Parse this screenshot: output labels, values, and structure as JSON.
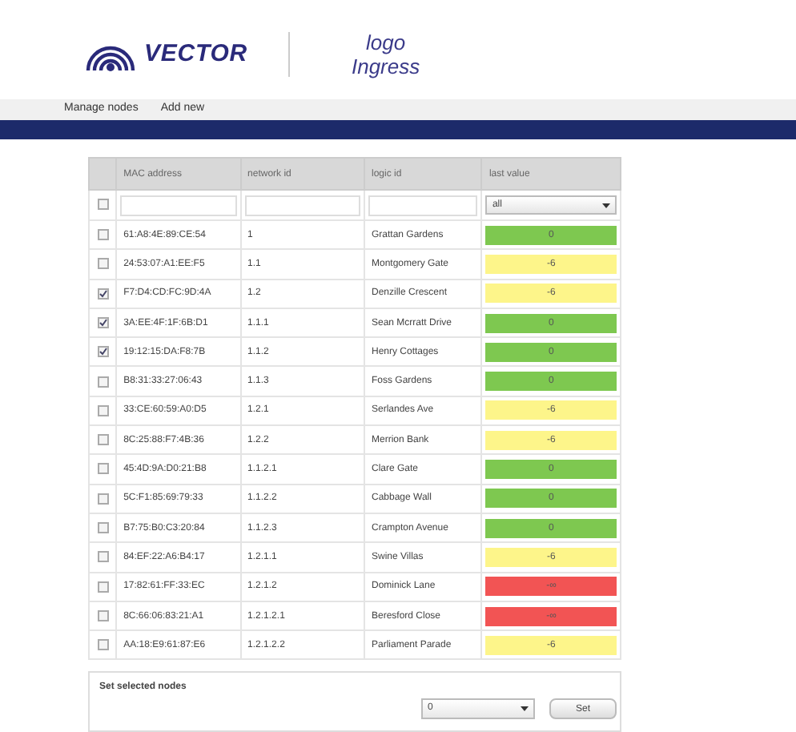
{
  "header": {
    "brand": "VECTOR",
    "tagline_1": "logo",
    "tagline_2": "Ingress"
  },
  "nav": [
    {
      "label": "Manage nodes"
    },
    {
      "label": "Add new"
    }
  ],
  "table": {
    "columns": [
      "MAC address",
      "network id",
      "logic id",
      "last value"
    ],
    "filter": {
      "checked": false,
      "value_filter": "all"
    },
    "rows": [
      {
        "checked": false,
        "mac": "61:A8:4E:89:CE:54",
        "network_id": "1",
        "logic_id": "Grattan Gardens",
        "value": "0",
        "color": "#7ec850"
      },
      {
        "checked": false,
        "mac": "24:53:07:A1:EE:F5",
        "network_id": "1.1",
        "logic_id": "Montgomery Gate",
        "value": "-6",
        "color": "#fdf58a"
      },
      {
        "checked": true,
        "mac": "F7:D4:CD:FC:9D:4A",
        "network_id": "1.2",
        "logic_id": "Denzille Crescent",
        "value": "-6",
        "color": "#fdf58a"
      },
      {
        "checked": true,
        "mac": "3A:EE:4F:1F:6B:D1",
        "network_id": "1.1.1",
        "logic_id": "Sean Mcrratt Drive",
        "value": "0",
        "color": "#7ec850"
      },
      {
        "checked": true,
        "mac": "19:12:15:DA:F8:7B",
        "network_id": "1.1.2",
        "logic_id": "Henry Cottages",
        "value": "0",
        "color": "#7ec850"
      },
      {
        "checked": false,
        "mac": "B8:31:33:27:06:43",
        "network_id": "1.1.3",
        "logic_id": "Foss Gardens",
        "value": "0",
        "color": "#7ec850"
      },
      {
        "checked": false,
        "mac": "33:CE:60:59:A0:D5",
        "network_id": "1.2.1",
        "logic_id": "Serlandes Ave",
        "value": "-6",
        "color": "#fdf58a"
      },
      {
        "checked": false,
        "mac": "8C:25:88:F7:4B:36",
        "network_id": "1.2.2",
        "logic_id": "Merrion Bank",
        "value": "-6",
        "color": "#fdf58a"
      },
      {
        "checked": false,
        "mac": "45:4D:9A:D0:21:B8",
        "network_id": "1.1.2.1",
        "logic_id": "Clare Gate",
        "value": "0",
        "color": "#7ec850"
      },
      {
        "checked": false,
        "mac": "5C:F1:85:69:79:33",
        "network_id": "1.1.2.2",
        "logic_id": "Cabbage Wall",
        "value": "0",
        "color": "#7ec850"
      },
      {
        "checked": false,
        "mac": "B7:75:B0:C3:20:84",
        "network_id": "1.1.2.3",
        "logic_id": "Crampton Avenue",
        "value": "0",
        "color": "#7ec850"
      },
      {
        "checked": false,
        "mac": "84:EF:22:A6:B4:17",
        "network_id": "1.2.1.1",
        "logic_id": "Swine Villas",
        "value": "-6",
        "color": "#fdf58a"
      },
      {
        "checked": false,
        "mac": "17:82:61:FF:33:EC",
        "network_id": "1.2.1.2",
        "logic_id": "Dominick Lane",
        "value": "-∞",
        "color": "#f25454"
      },
      {
        "checked": false,
        "mac": "8C:66:06:83:21:A1",
        "network_id": "1.2.1.2.1",
        "logic_id": "Beresford Close",
        "value": "-∞",
        "color": "#f25454"
      },
      {
        "checked": false,
        "mac": "AA:18:E9:61:87:E6",
        "network_id": "1.2.1.2.2",
        "logic_id": "Parliament Parade",
        "value": "-6",
        "color": "#fdf58a"
      }
    ]
  },
  "set_panel": {
    "title": "Set selected nodes",
    "select_value": "0",
    "button": "Set"
  }
}
